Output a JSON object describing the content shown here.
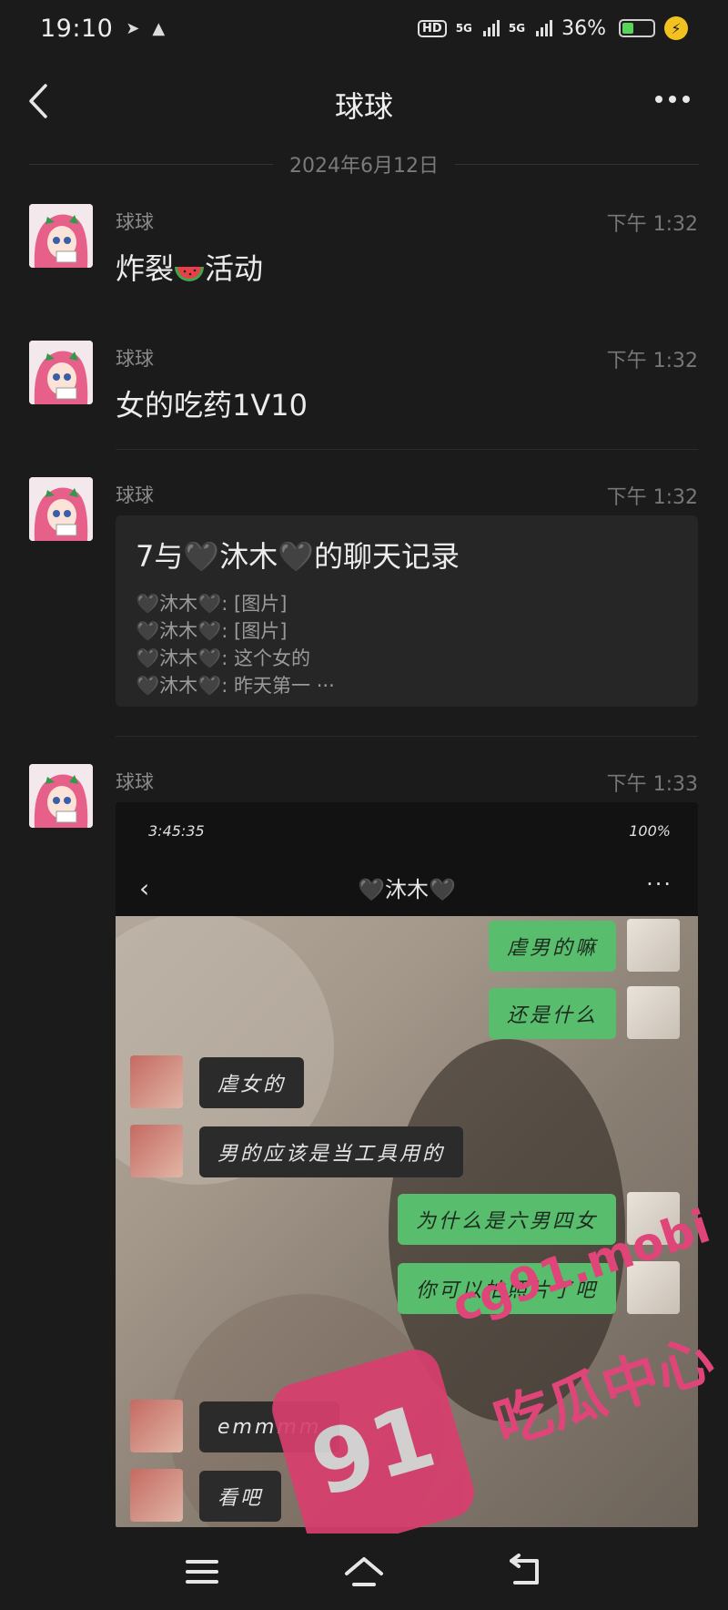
{
  "status_bar": {
    "time": "19:10",
    "network_1": "5G",
    "network_2": "5G",
    "battery_percent": "36%",
    "battery_level": 0.36
  },
  "header": {
    "title": "球球"
  },
  "date_separator": "2024年6月12日",
  "messages": [
    {
      "sender": "球球",
      "time": "下午 1:32",
      "text_before": "炸裂",
      "text_after": "活动"
    },
    {
      "sender": "球球",
      "time": "下午 1:32",
      "text": "女的吃药1V10"
    },
    {
      "sender": "球球",
      "time": "下午 1:32",
      "card": {
        "title": "7与🖤沐木🖤的聊天记录",
        "lines": [
          "🖤沐木🖤: [图片]",
          "🖤沐木🖤: [图片]",
          "🖤沐木🖤: 这个女的",
          "🖤沐木🖤: 昨天第一 ···"
        ]
      }
    },
    {
      "sender": "球球",
      "time": "下午 1:33"
    }
  ],
  "embedded": {
    "status_time": "3:45:35",
    "status_battery": "100%",
    "title": "🖤沐木🖤",
    "bubbles": [
      "虐男的嘛",
      "还是什么",
      "虐女的",
      "男的应该是当工具用的",
      "为什么是六男四女",
      "你可以拍照片了吧",
      "emmmm",
      "看吧"
    ]
  },
  "watermark": {
    "badge": "91",
    "line1": "cg91.mobi",
    "line2": "吃瓜中心"
  },
  "colors": {
    "background": "#1b1b1b",
    "bubble_green": "#58be6d",
    "watermark": "#e0457a"
  }
}
